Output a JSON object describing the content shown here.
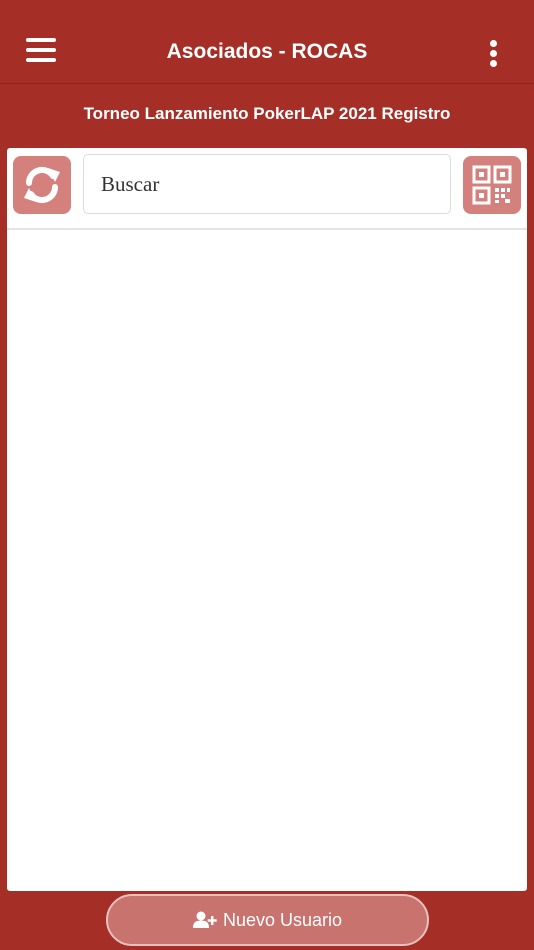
{
  "header": {
    "title": "Asociados - ROCAS",
    "menu_icon": "hamburger-menu-icon",
    "more_icon": "vertical-dots-icon"
  },
  "subtitle": "Torneo Lanzamiento PokerLAP 2021 Registro",
  "search": {
    "placeholder": "Buscar",
    "refresh_icon": "refresh-icon",
    "qr_icon": "qr-code-icon"
  },
  "list": {
    "items": []
  },
  "footer": {
    "new_user_label": "Nuevo Usuario",
    "new_user_icon": "user-plus-icon"
  },
  "colors": {
    "primary": "#a52f27",
    "button_light": "#d4817d",
    "footer_button": "#c8736e"
  }
}
